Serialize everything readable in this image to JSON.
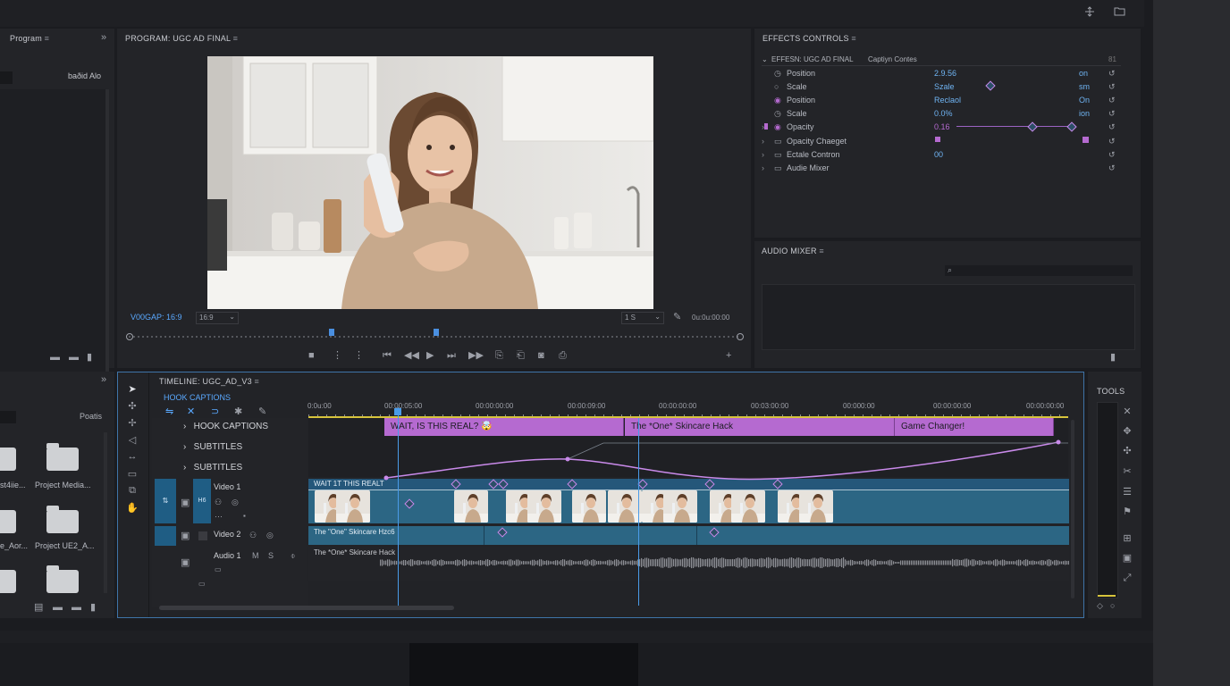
{
  "top_icons": [
    "expand-icon",
    "folder-icon"
  ],
  "project_panel": {
    "tab": "Program",
    "tab_suffix": "≡",
    "item": "baðid Alo"
  },
  "program_monitor": {
    "title": "PROGRAM: UGC AD FINAL",
    "timecode": "V00GAP: 16:9",
    "ratio": "16:9",
    "quality": "1 S",
    "duration": "0u:0u:00:00"
  },
  "effects_controls": {
    "title": "EFFECTS CONTROLS",
    "sequence": "EFFESN: UGC AD FINAL",
    "clip": "Captiyn Contes",
    "corner": "81",
    "rows": [
      {
        "name": "Position",
        "value": "2.9.56",
        "end": "on"
      },
      {
        "name": "Scale",
        "value": "Szale",
        "end": "sm"
      },
      {
        "name": "Position",
        "value": "Reclaol",
        "end": "On"
      },
      {
        "name": "Scale",
        "value": "0.0%",
        "end": "ion"
      },
      {
        "name": "Opacity",
        "value": "0.16",
        "end": ""
      },
      {
        "name": "Opacity Chaeget",
        "value": "",
        "end": ""
      },
      {
        "name": "Ectale Contron",
        "value": "00",
        "end": ""
      },
      {
        "name": "Audie Mixer",
        "value": "",
        "end": ""
      }
    ]
  },
  "audio_mixer": {
    "title": "AUDIO MIXER"
  },
  "media_panel": {
    "label": "Poatis",
    "items": [
      {
        "name": "st4iie..."
      },
      {
        "name": "Project Media..."
      },
      {
        "name": "e_Aor..."
      },
      {
        "name": "Project UE2_A..."
      }
    ]
  },
  "timeline": {
    "title": "TIMELINE: UGC_AD_V3",
    "section": "HOOK CAPTIONS",
    "ruler": [
      "0:0u:00",
      "00:00:05:00",
      "00:00:00:00",
      "00:00:09:00",
      "00:00:00:00",
      "00:03:00:00",
      "00:000:00",
      "00:00:00:00",
      "00:00:00:00"
    ],
    "caption_tracks": [
      "HOOK CAPTIONS",
      "SUBTITLES",
      "SUBTITLES"
    ],
    "captions": [
      "WAIT, IS THIS REAL? 🤯",
      "The *One* Skincare Hack",
      "Game Changer!"
    ],
    "video1_label": "Video 1",
    "video2_label": "Video 2",
    "audio1_label": "Audio 1",
    "video1_clip": "WAIT 1T THIS REALT",
    "video2_clip": "The \"One\" Skincare Hzc6",
    "audio1_clip": "The *One* Skincare Hack"
  },
  "tools_panel": {
    "title": "TOOLS"
  }
}
